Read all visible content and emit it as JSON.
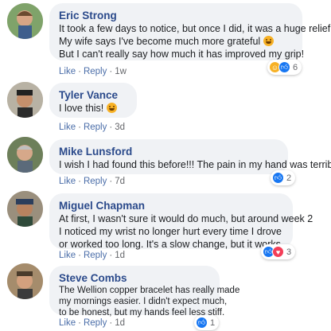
{
  "comments": [
    {
      "author": "Eric Strong",
      "lines": [
        "It took a few days to notice, but once I did, it was a huge relief.",
        "My wife says I've become much more grateful",
        "But I can't really say how much it has improved my grip!"
      ],
      "emoji_on_line": 1,
      "like": "Like",
      "reply": "Reply",
      "time": "1w",
      "reactions": [
        "haha-icon",
        "like-icon"
      ],
      "reaction_count": "6"
    },
    {
      "author": "Tyler Vance",
      "lines": [
        "I love this!"
      ],
      "emoji_on_line": 0,
      "like": "Like",
      "reply": "Reply",
      "time": "3d"
    },
    {
      "author": "Mike Lunsford",
      "lines": [
        "I wish I had found this before!!! The pain in my hand was terrible."
      ],
      "like": "Like",
      "reply": "Reply",
      "time": "7d",
      "reactions": [
        "like-icon"
      ],
      "reaction_count": "2"
    },
    {
      "author": "Miguel Chapman",
      "lines": [
        "At first, I wasn't sure it would do much, but around week 2",
        "I noticed my wrist no longer hurt every time I drove",
        "or worked too long. It's a slow change, but it works."
      ],
      "like": "Like",
      "reply": "Reply",
      "time": "1d",
      "reactions": [
        "like-icon",
        "love-icon"
      ],
      "reaction_count": "3"
    },
    {
      "author": "Steve Combs",
      "lines": [
        "The Wellion copper bracelet has really made",
        "my mornings easier. I didn't expect much,",
        "to be honest, but my hands feel less stiff."
      ],
      "like": "Like",
      "reply": "Reply",
      "time": "1d",
      "reactions": [
        "like-icon"
      ],
      "reaction_count": "1"
    }
  ],
  "colors": {
    "author": "#2b4a8b",
    "bubble": "#f0f2f5",
    "like": "#1877f2",
    "love": "#f33e58",
    "haha": "#f7b125"
  }
}
